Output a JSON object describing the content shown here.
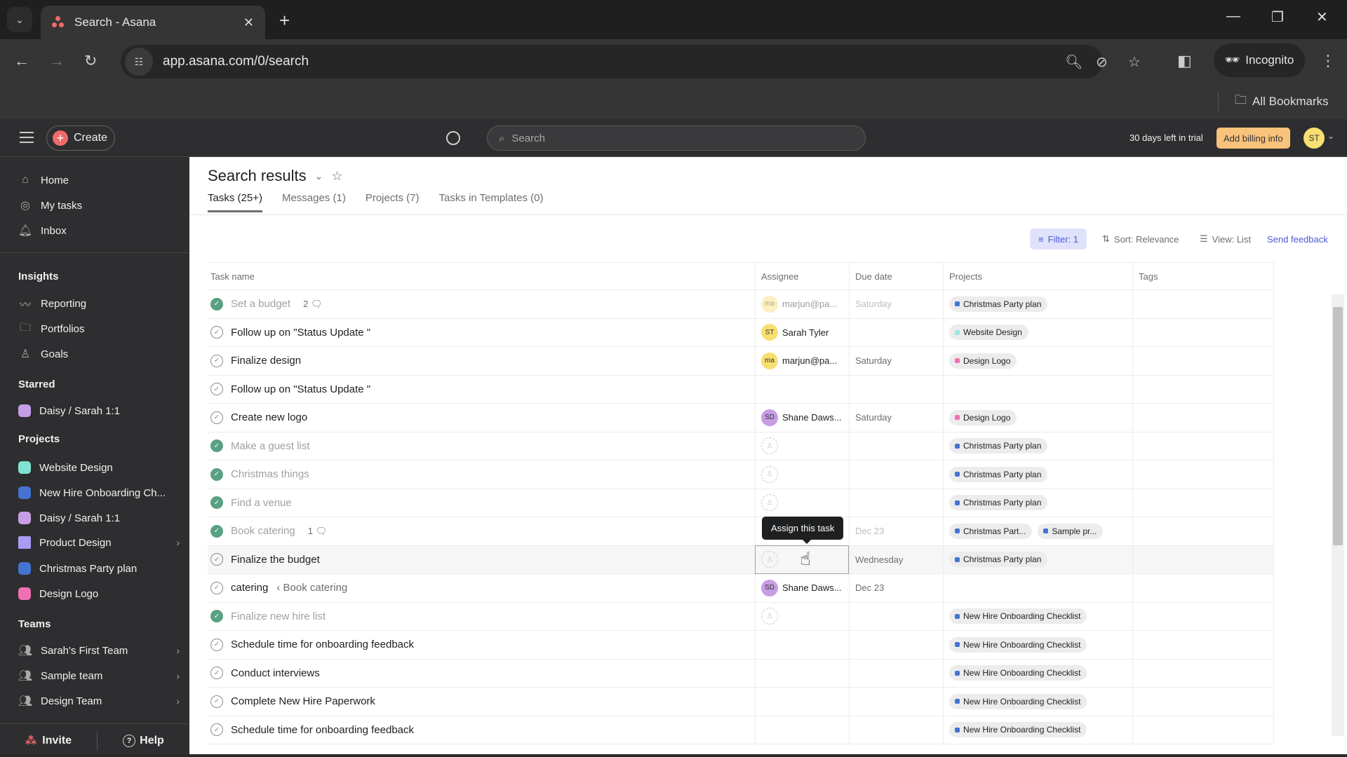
{
  "browser": {
    "tab_title": "Search - Asana",
    "url": "app.asana.com/0/search",
    "profile_label": "Incognito",
    "bookmarks_label": "All Bookmarks"
  },
  "appbar": {
    "create_label": "Create",
    "search_placeholder": "Search",
    "trial_text": "30 days left in trial",
    "billing_label": "Add billing info",
    "user_initials": "ST"
  },
  "sidebar": {
    "nav": [
      {
        "label": "Home",
        "icon": "home-icon"
      },
      {
        "label": "My tasks",
        "icon": "check-circle-icon"
      },
      {
        "label": "Inbox",
        "icon": "bell-icon"
      }
    ],
    "insights_heading": "Insights",
    "insights": [
      {
        "label": "Reporting",
        "icon": "chart-line-icon"
      },
      {
        "label": "Portfolios",
        "icon": "folder-icon"
      },
      {
        "label": "Goals",
        "icon": "person-icon"
      }
    ],
    "starred_heading": "Starred",
    "starred": [
      {
        "label": "Daisy / Sarah 1:1",
        "color": "#c79de6"
      }
    ],
    "projects_heading": "Projects",
    "projects": [
      {
        "label": "Website Design",
        "color": "#7fe2d2"
      },
      {
        "label": "New Hire Onboarding Ch...",
        "color": "#4573d2"
      },
      {
        "label": "Daisy / Sarah 1:1",
        "color": "#c79de6"
      },
      {
        "label": "Product Design",
        "color": "#a89cf6"
      },
      {
        "label": "Christmas Party plan",
        "color": "#4573d2"
      },
      {
        "label": "Design Logo",
        "color": "#f26fb2"
      }
    ],
    "teams_heading": "Teams",
    "teams": [
      {
        "label": "Sarah's First Team"
      },
      {
        "label": "Sample team"
      },
      {
        "label": "Design Team"
      }
    ],
    "invite_label": "Invite",
    "help_label": "Help"
  },
  "main": {
    "title": "Search results",
    "tabs": [
      {
        "label": "Tasks (25+)"
      },
      {
        "label": "Messages (1)"
      },
      {
        "label": "Projects (7)"
      },
      {
        "label": "Tasks in Templates (0)"
      }
    ],
    "filter_label": "Filter: 1",
    "sort_label": "Sort: Relevance",
    "view_label": "View: List",
    "feedback_label": "Send feedback",
    "columns": [
      "Task name",
      "Assignee",
      "Due date",
      "Projects",
      "Tags"
    ],
    "tooltip": "Assign this task",
    "rows": [
      {
        "name": "Set a budget",
        "done": true,
        "comments": "2",
        "assignee": "marjun@pa...",
        "initials": "ma",
        "avcolor": "#f8df72",
        "due": "Saturday",
        "projects": [
          {
            "label": "Christmas Party plan",
            "color": "#4573d2"
          }
        ]
      },
      {
        "name": "Follow up on \"Status Update \"",
        "done": false,
        "assignee": "Sarah Tyler",
        "initials": "ST",
        "avcolor": "#f8df72",
        "due": "",
        "projects": [
          {
            "label": "Website Design",
            "color": "#9ee7e3"
          }
        ]
      },
      {
        "name": "Finalize design",
        "done": false,
        "assignee": "marjun@pa...",
        "initials": "ma",
        "avcolor": "#f8df72",
        "due": "Saturday",
        "projects": [
          {
            "label": "Design Logo",
            "color": "#f26fb2"
          }
        ]
      },
      {
        "name": "Follow up on \"Status Update \"",
        "done": false,
        "assignee": "",
        "due": "",
        "projects": []
      },
      {
        "name": "Create new logo",
        "done": false,
        "assignee": "Shane Daws...",
        "initials": "SD",
        "avcolor": "#c79de6",
        "due": "Saturday",
        "projects": [
          {
            "label": "Design Logo",
            "color": "#f26fb2"
          }
        ]
      },
      {
        "name": "Make a guest list",
        "done": true,
        "assignee": "",
        "empty_av": true,
        "due": "",
        "projects": [
          {
            "label": "Christmas Party plan",
            "color": "#4573d2"
          }
        ]
      },
      {
        "name": "Christmas things",
        "done": true,
        "assignee": "",
        "empty_av": true,
        "due": "",
        "projects": [
          {
            "label": "Christmas Party plan",
            "color": "#4573d2"
          }
        ]
      },
      {
        "name": "Find a venue",
        "done": true,
        "assignee": "",
        "empty_av": true,
        "due": "",
        "projects": [
          {
            "label": "Christmas Party plan",
            "color": "#4573d2"
          }
        ]
      },
      {
        "name": "Book catering",
        "done": true,
        "comments": "1",
        "assignee": "",
        "due": "Dec 23",
        "projects": [
          {
            "label": "Christmas Part...",
            "color": "#4573d2"
          },
          {
            "label": "Sample pr...",
            "color": "#4573d2"
          }
        ]
      },
      {
        "name": "Finalize the budget",
        "done": false,
        "assignee": "",
        "empty_av": true,
        "highlight": true,
        "due": "Wednesday",
        "projects": [
          {
            "label": "Christmas Party plan",
            "color": "#4573d2"
          }
        ]
      },
      {
        "name": "catering",
        "parent": "‹ Book catering",
        "done": false,
        "assignee": "Shane Daws...",
        "initials": "SD",
        "avcolor": "#c79de6",
        "due": "Dec 23",
        "projects": []
      },
      {
        "name": "Finalize new hire list",
        "done": true,
        "assignee": "",
        "empty_av": true,
        "due": "",
        "projects": [
          {
            "label": "New Hire Onboarding Checklist",
            "color": "#4573d2"
          }
        ]
      },
      {
        "name": "Schedule time for onboarding feedback",
        "done": false,
        "assignee": "",
        "due": "",
        "projects": [
          {
            "label": "New Hire Onboarding Checklist",
            "color": "#4573d2"
          }
        ]
      },
      {
        "name": "Conduct interviews",
        "done": false,
        "assignee": "",
        "due": "",
        "projects": [
          {
            "label": "New Hire Onboarding Checklist",
            "color": "#4573d2"
          }
        ]
      },
      {
        "name": "Complete New Hire Paperwork",
        "done": false,
        "assignee": "",
        "due": "",
        "projects": [
          {
            "label": "New Hire Onboarding Checklist",
            "color": "#4573d2"
          }
        ]
      },
      {
        "name": "Schedule time for onboarding feedback",
        "done": false,
        "assignee": "",
        "due": "",
        "projects": [
          {
            "label": "New Hire Onboarding Checklist",
            "color": "#4573d2"
          }
        ]
      }
    ]
  }
}
